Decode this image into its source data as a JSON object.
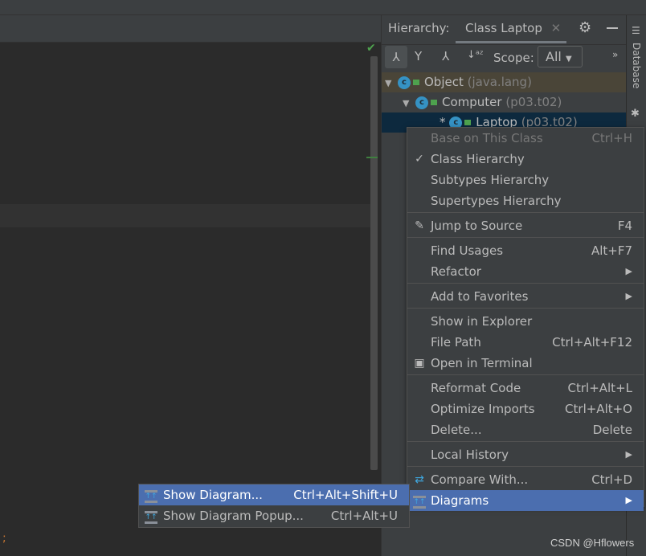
{
  "hierarchy": {
    "label": "Hierarchy:",
    "tab": "Class Laptop",
    "scope_label": "Scope:",
    "scope_value": "All",
    "tree": [
      {
        "name": "Object",
        "pkg": "(java.lang)"
      },
      {
        "name": "Computer",
        "pkg": "(p03.t02)"
      },
      {
        "name": "Laptop",
        "pkg": "(p03.t02)",
        "marker": "*"
      }
    ]
  },
  "sidebar_right": {
    "database": "Database"
  },
  "menu": {
    "items": [
      {
        "label": "Base on This Class",
        "shortcut": "Ctrl+H"
      },
      {
        "label": "Class Hierarchy",
        "checked": "✓"
      },
      {
        "label": "Subtypes Hierarchy"
      },
      {
        "label": "Supertypes Hierarchy"
      },
      {
        "label": "Jump to Source",
        "shortcut": "F4"
      },
      {
        "label": "Find Usages",
        "shortcut": "Alt+F7"
      },
      {
        "label": "Refactor"
      },
      {
        "label": "Add to Favorites"
      },
      {
        "label": "Show in Explorer"
      },
      {
        "label": "File Path",
        "shortcut": "Ctrl+Alt+F12"
      },
      {
        "label": "Open in Terminal"
      },
      {
        "label": "Reformat Code",
        "shortcut": "Ctrl+Alt+L"
      },
      {
        "label": "Optimize Imports",
        "shortcut": "Ctrl+Alt+O"
      },
      {
        "label": "Delete...",
        "shortcut": "Delete"
      },
      {
        "label": "Local History"
      },
      {
        "label": "Compare With...",
        "shortcut": "Ctrl+D"
      },
      {
        "label": "Diagrams"
      }
    ]
  },
  "submenu": {
    "items": [
      {
        "label": "Show Diagram...",
        "shortcut": "Ctrl+Alt+Shift+U"
      },
      {
        "label": "Show Diagram Popup...",
        "shortcut": "Ctrl+Alt+U"
      }
    ]
  },
  "colors": {
    "selection": "#4b6eaf",
    "background": "#2b2b2b",
    "panel": "#3c3f41"
  },
  "watermark": "CSDN @Hflowers"
}
